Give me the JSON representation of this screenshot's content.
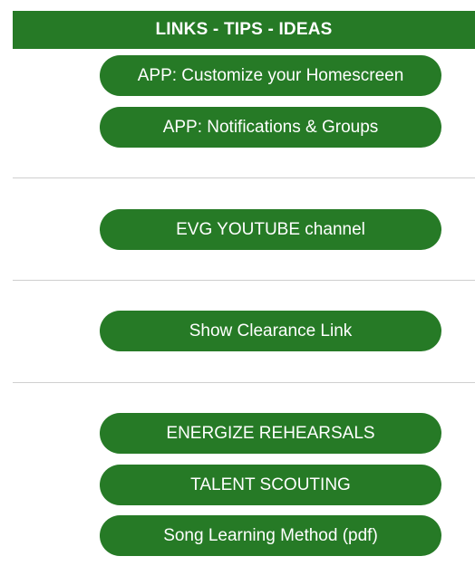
{
  "header": {
    "title": "LINKS - TIPS - IDEAS"
  },
  "buttons": [
    {
      "label": "APP: Customize your Homescreen"
    },
    {
      "label": "APP: Notifications & Groups"
    },
    {
      "label": "EVG YOUTUBE channel"
    },
    {
      "label": "Show Clearance Link"
    },
    {
      "label": "ENERGIZE REHEARSALS"
    },
    {
      "label": "TALENT SCOUTING"
    },
    {
      "label": "Song Learning Method (pdf)"
    }
  ],
  "colors": {
    "accent": "#267a26",
    "text_on_accent": "#ffffff",
    "divider": "#cfcfcf"
  }
}
